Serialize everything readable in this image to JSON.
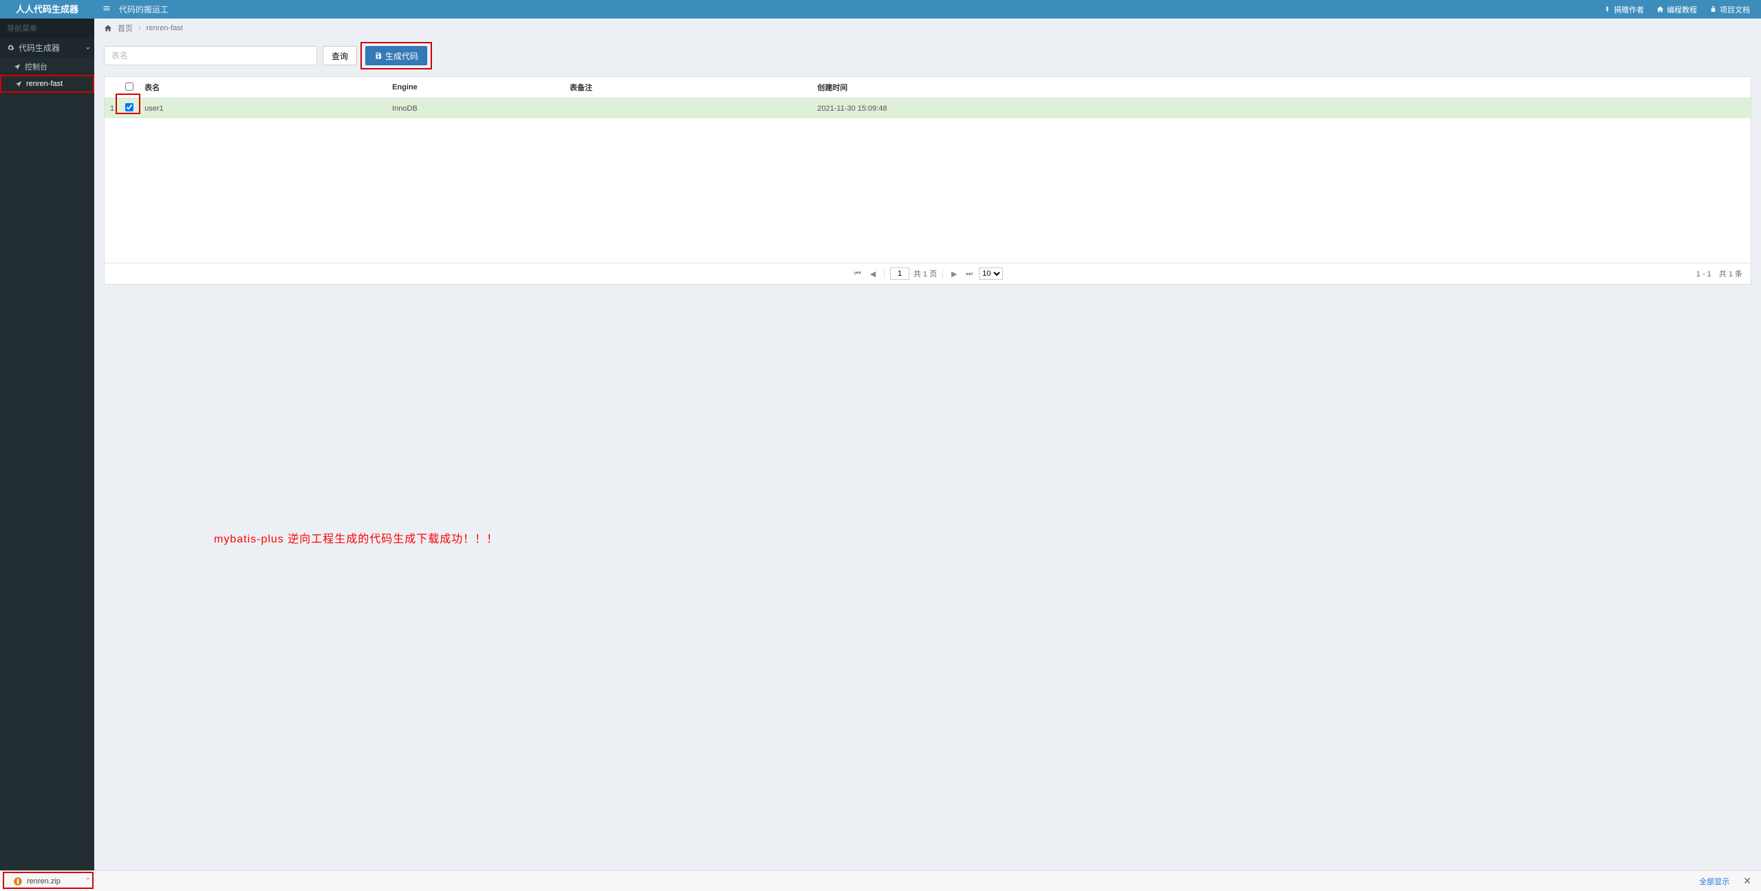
{
  "header": {
    "logo": "人人代码生成器",
    "subtitle": "代码的搬运工",
    "links": {
      "donate": "捐赠作者",
      "tutorial": "编程教程",
      "docs": "项目文档"
    }
  },
  "sidebar": {
    "section_label": "导航菜单",
    "items": [
      {
        "label": "代码生成器",
        "type": "expandable"
      },
      {
        "label": "控制台",
        "type": "sub"
      },
      {
        "label": "renren-fast",
        "type": "sub_active"
      }
    ]
  },
  "breadcrumb": {
    "home": "首页",
    "current": "renren-fast"
  },
  "toolbar": {
    "search_placeholder": "表名",
    "query_label": "查询",
    "generate_label": "生成代码"
  },
  "table": {
    "headers": {
      "name": "表名",
      "engine": "Engine",
      "remark": "表备注",
      "created": "创建时间"
    },
    "rows": [
      {
        "index": "1",
        "checked": true,
        "name": "user1",
        "engine": "InnoDB",
        "remark": "",
        "created": "2021-11-30 15:09:48"
      }
    ]
  },
  "pagination": {
    "page_input": "1",
    "total_pages_text": "共 1 页",
    "page_size": "10",
    "summary": "1 - 1　共 1 条"
  },
  "annotation": "mybatis-plus 逆向工程生成的代码生成下载成功！！！",
  "download_bar": {
    "filename": "renren.zip",
    "show_all": "全部显示"
  }
}
